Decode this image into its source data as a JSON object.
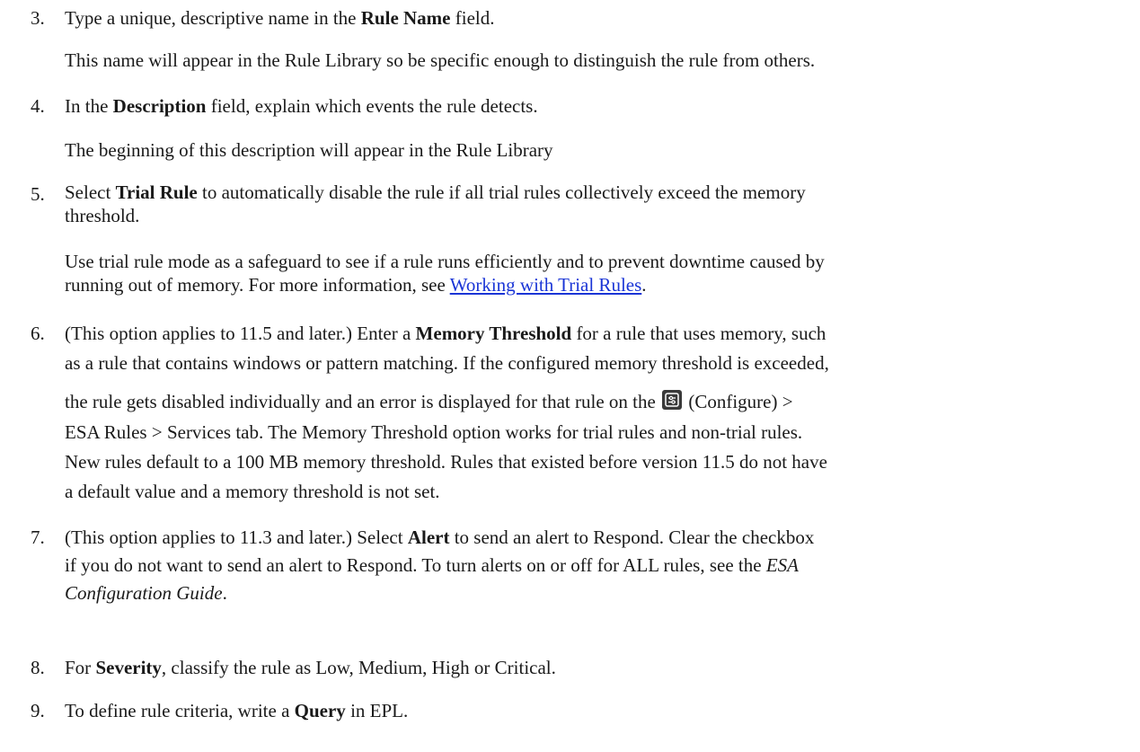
{
  "steps": [
    {
      "number": "3.",
      "pre": "Type a unique, descriptive name in the ",
      "bold": "Rule Name",
      "post": " field.",
      "note": "This name will appear in the Rule Library so be specific enough to distinguish the rule from others."
    },
    {
      "number": "4.",
      "pre": "In the ",
      "bold": "Description",
      "post": " field, explain which events the rule detects.",
      "note": "The beginning of this description will appear in the Rule Library"
    },
    {
      "number": "5.",
      "pre": "Select ",
      "bold": "Trial Rule",
      "line1_post": " to automatically disable the rule if all trial rules collectively exceed the memory",
      "line2": "threshold.",
      "note_line1": "Use trial rule mode as a safeguard to see if a rule runs efficiently and to prevent downtime caused by",
      "note_line2_pre": "running out of memory. For more information, see ",
      "note_link": "Working with Trial Rules",
      "note_line2_post": "."
    },
    {
      "number": "6.",
      "line1_pre": "(This option applies to 11.5 and later.) Enter a ",
      "line1_bold": "Memory Threshold",
      "line1_post": " for a rule that uses memory, such",
      "line2": "as a rule that contains windows or pattern matching. If the configured memory threshold is exceeded,",
      "line3_pre": "the rule gets disabled individually and an error is displayed for that rule on the ",
      "line3_icon": "configure-icon",
      "line3_post": " (Configure) >",
      "line4": "ESA Rules > Services tab. The Memory Threshold option works for trial rules and non-trial rules.",
      "line5": "New rules default to a 100 MB memory threshold. Rules that existed before version 11.5 do not have",
      "line6": "a default value and a memory threshold is not set."
    },
    {
      "number": "7.",
      "line1_pre": "(This option applies to 11.3 and later.) Select ",
      "line1_bold": "Alert",
      "line1_post": " to send an alert to Respond. Clear the checkbox",
      "line2_pre": "if you do not want to send an alert to Respond. To turn alerts on or off for ALL rules, see the ",
      "line2_italic": "ESA",
      "line3_italic": "Configuration Guide",
      "line3_post": "."
    },
    {
      "number": "8.",
      "pre": "For ",
      "bold": "Severity",
      "post": ", classify the rule as Low, Medium, High or Critical."
    },
    {
      "number": "9.",
      "pre": "To define rule criteria, write a ",
      "bold": "Query",
      "post": " in EPL."
    }
  ]
}
